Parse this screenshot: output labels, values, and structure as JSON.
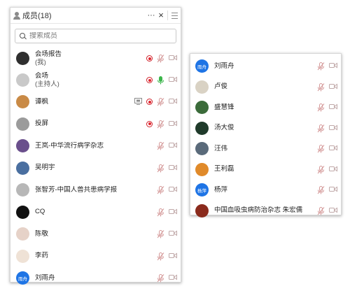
{
  "left_panel": {
    "title": "成员(18)",
    "more_label": "···",
    "close_label": "×",
    "search_placeholder": "搜索成员",
    "members": [
      {
        "name": "会场报告",
        "sub": "(我)",
        "avatar_color": "#2f2f2f",
        "avatar_text": "",
        "record": true,
        "mic": "muted",
        "cam": "off",
        "screen": false
      },
      {
        "name": "会场",
        "sub": "(主持人)",
        "avatar_color": "#c9c9c9",
        "avatar_text": "",
        "record": true,
        "mic": "active",
        "cam": "off",
        "screen": false
      },
      {
        "name": "谭枫",
        "sub": "",
        "avatar_color": "#c98a46",
        "avatar_text": "",
        "record": true,
        "mic": "muted",
        "cam": "off",
        "screen": true
      },
      {
        "name": "投屏",
        "sub": "",
        "avatar_color": "#9b9b9b",
        "avatar_text": "",
        "record": true,
        "mic": "muted",
        "cam": "off",
        "screen": false
      },
      {
        "name": "王岚-中华流行病学杂志",
        "sub": "",
        "avatar_color": "#6a4f8c",
        "avatar_text": "",
        "record": false,
        "mic": "muted",
        "cam": "off",
        "screen": false
      },
      {
        "name": "吴明宇",
        "sub": "",
        "avatar_color": "#4a6fa0",
        "avatar_text": "",
        "record": false,
        "mic": "muted",
        "cam": "off",
        "screen": false
      },
      {
        "name": "张智芳-中国人兽共患病学报",
        "sub": "",
        "avatar_color": "#b7b7b7",
        "avatar_text": "",
        "record": false,
        "mic": "muted",
        "cam": "off",
        "screen": false
      },
      {
        "name": "CQ",
        "sub": "",
        "avatar_color": "#111111",
        "avatar_text": "",
        "record": false,
        "mic": "muted",
        "cam": "off",
        "screen": false
      },
      {
        "name": "陈敬",
        "sub": "",
        "avatar_color": "#e6d2c8",
        "avatar_text": "",
        "record": false,
        "mic": "muted",
        "cam": "off",
        "screen": false
      },
      {
        "name": "李药",
        "sub": "",
        "avatar_color": "#efe2d6",
        "avatar_text": "",
        "record": false,
        "mic": "muted",
        "cam": "off",
        "screen": false
      },
      {
        "name": "刘雨舟",
        "sub": "",
        "avatar_color": "#1e74e5",
        "avatar_text": "雨舟",
        "record": false,
        "mic": "muted",
        "cam": "off",
        "screen": false
      }
    ]
  },
  "right_panel": {
    "members": [
      {
        "name": "刘雨舟",
        "avatar_color": "#1e74e5",
        "avatar_text": "雨舟",
        "mic": "muted",
        "cam": "off"
      },
      {
        "name": "卢俊",
        "avatar_color": "#d9d2c4",
        "avatar_text": "",
        "mic": "muted",
        "cam": "off"
      },
      {
        "name": "盛慧锋",
        "avatar_color": "#3b6b3a",
        "avatar_text": "",
        "mic": "muted",
        "cam": "off"
      },
      {
        "name": "汤大俊",
        "avatar_color": "#1f3a2a",
        "avatar_text": "",
        "mic": "muted",
        "cam": "off"
      },
      {
        "name": "汪伟",
        "avatar_color": "#5a6a7a",
        "avatar_text": "",
        "mic": "muted",
        "cam": "off"
      },
      {
        "name": "王利磊",
        "avatar_color": "#e08a2a",
        "avatar_text": "",
        "mic": "muted",
        "cam": "off"
      },
      {
        "name": "杨萍",
        "avatar_color": "#1e74e5",
        "avatar_text": "杨萍",
        "mic": "muted",
        "cam": "off"
      },
      {
        "name": "中国血吸虫病防治杂志 朱宏儒",
        "avatar_color": "#8a2a1c",
        "avatar_text": "",
        "mic": "muted",
        "cam": "off"
      }
    ]
  },
  "colors": {
    "record_red": "#e0232d",
    "mic_active_green": "#3bb54a",
    "muted_icon": "#d59a9a",
    "cam_off": "#c0a8a8"
  }
}
